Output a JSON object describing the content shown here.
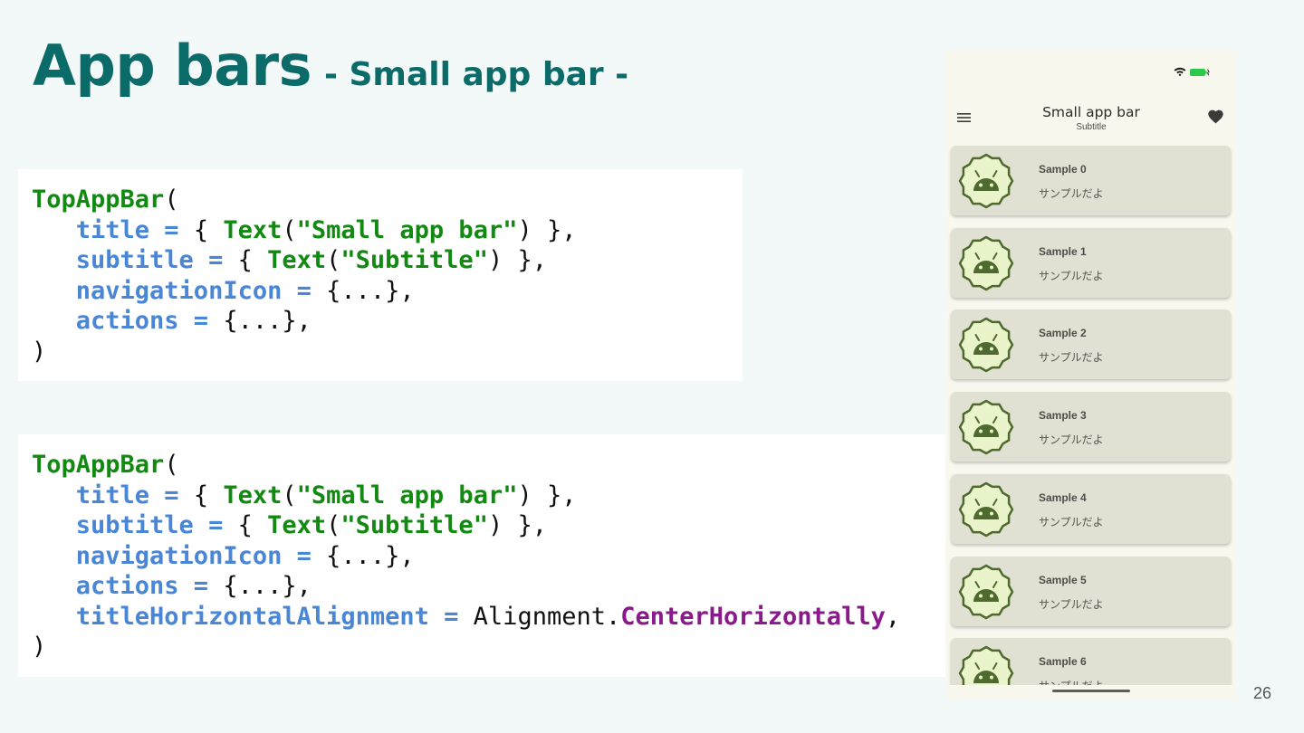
{
  "slide": {
    "title": "App bars",
    "subtitle": "- Small app bar -",
    "page_number": "26"
  },
  "code_blocks": [
    {
      "lines": [
        [
          {
            "t": "TopAppBar",
            "c": "g"
          },
          {
            "t": "(",
            "c": "k"
          }
        ],
        [
          {
            "t": "   title = ",
            "c": "b"
          },
          {
            "t": "{ ",
            "c": "k"
          },
          {
            "t": "Text",
            "c": "g"
          },
          {
            "t": "(",
            "c": "k"
          },
          {
            "t": "\"Small app bar\"",
            "c": "g"
          },
          {
            "t": ") },",
            "c": "k"
          }
        ],
        [
          {
            "t": "   subtitle = ",
            "c": "b"
          },
          {
            "t": "{ ",
            "c": "k"
          },
          {
            "t": "Text",
            "c": "g"
          },
          {
            "t": "(",
            "c": "k"
          },
          {
            "t": "\"Subtitle\"",
            "c": "g"
          },
          {
            "t": ") },",
            "c": "k"
          }
        ],
        [
          {
            "t": "   navigationIcon = ",
            "c": "b"
          },
          {
            "t": "{...},",
            "c": "k"
          }
        ],
        [
          {
            "t": "   actions = ",
            "c": "b"
          },
          {
            "t": "{...},",
            "c": "k"
          }
        ],
        [
          {
            "t": ")",
            "c": "k"
          }
        ]
      ]
    },
    {
      "lines": [
        [
          {
            "t": "TopAppBar",
            "c": "g"
          },
          {
            "t": "(",
            "c": "k"
          }
        ],
        [
          {
            "t": "   title = ",
            "c": "b"
          },
          {
            "t": "{ ",
            "c": "k"
          },
          {
            "t": "Text",
            "c": "g"
          },
          {
            "t": "(",
            "c": "k"
          },
          {
            "t": "\"Small app bar\"",
            "c": "g"
          },
          {
            "t": ") },",
            "c": "k"
          }
        ],
        [
          {
            "t": "   subtitle = ",
            "c": "b"
          },
          {
            "t": "{ ",
            "c": "k"
          },
          {
            "t": "Text",
            "c": "g"
          },
          {
            "t": "(",
            "c": "k"
          },
          {
            "t": "\"Subtitle\"",
            "c": "g"
          },
          {
            "t": ") },",
            "c": "k"
          }
        ],
        [
          {
            "t": "   navigationIcon = ",
            "c": "b"
          },
          {
            "t": "{...},",
            "c": "k"
          }
        ],
        [
          {
            "t": "   actions = ",
            "c": "b"
          },
          {
            "t": "{...},",
            "c": "k"
          }
        ],
        [
          {
            "t": "   titleHorizontalAlignment = ",
            "c": "b"
          },
          {
            "t": "Alignment.",
            "c": "k"
          },
          {
            "t": "CenterHorizontally",
            "c": "p"
          },
          {
            "t": ",",
            "c": "k"
          }
        ],
        [
          {
            "t": ")",
            "c": "k"
          }
        ]
      ]
    }
  ],
  "syntax_colors": {
    "g": "#128a12",
    "b": "#4a86d6",
    "k": "#111111",
    "p": "#8a1a8c"
  },
  "phone": {
    "status_icons": [
      "wifi-icon",
      "battery-charging-icon"
    ],
    "app_bar": {
      "navigation_icon": "menu-icon",
      "title": "Small app bar",
      "subtitle": "Subtitle",
      "action_icon": "favorite-icon"
    },
    "items": [
      {
        "title": "Sample 0",
        "subtitle": "サンプルだよ"
      },
      {
        "title": "Sample 1",
        "subtitle": "サンプルだよ"
      },
      {
        "title": "Sample 2",
        "subtitle": "サンプルだよ"
      },
      {
        "title": "Sample 3",
        "subtitle": "サンプルだよ"
      },
      {
        "title": "Sample 4",
        "subtitle": "サンプルだよ"
      },
      {
        "title": "Sample 5",
        "subtitle": "サンプルだよ"
      },
      {
        "title": "Sample 6",
        "subtitle": "サンプルだよ"
      }
    ],
    "colors": {
      "background": "#f9f8ef",
      "card": "#e0e1d2",
      "avatar_fill": "#e9f4cb",
      "avatar_stroke": "#4f6a2e",
      "android": "#4f6a2e",
      "battery": "#2bc94a"
    }
  }
}
